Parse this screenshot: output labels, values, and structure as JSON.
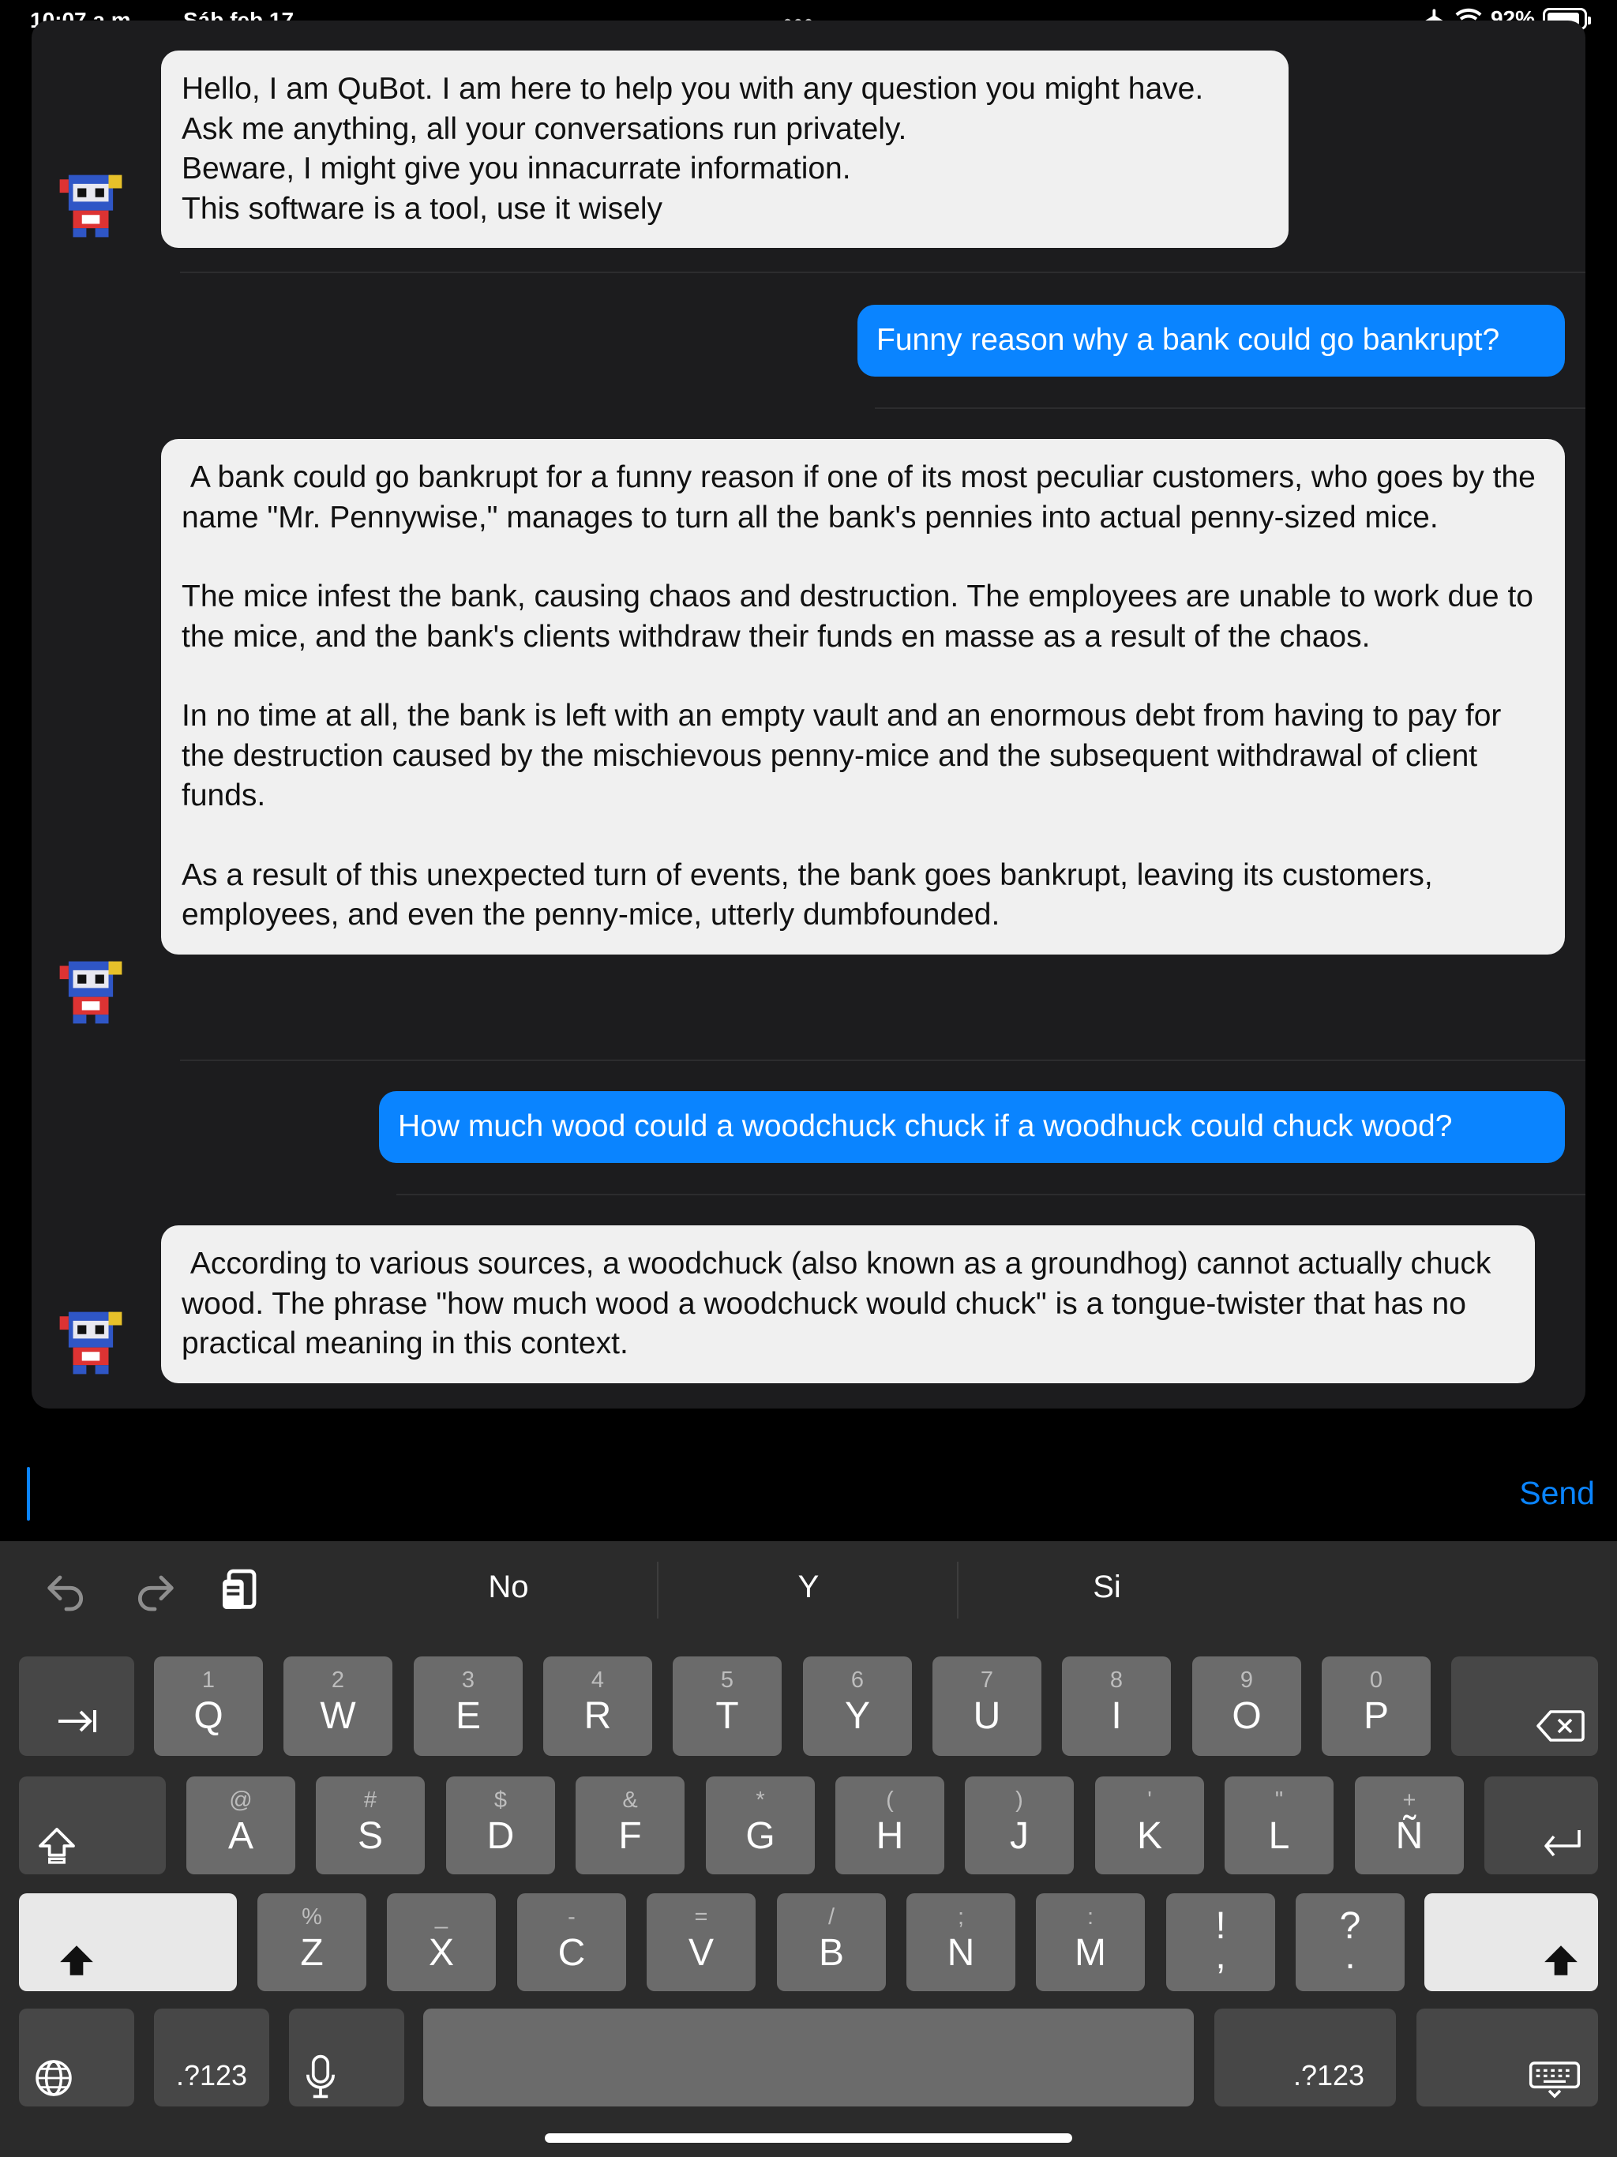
{
  "status_bar": {
    "time": "10:07 a.m.",
    "date": "Sáb feb 17",
    "battery": "92%"
  },
  "chat": {
    "messages": [
      {
        "role": "bot",
        "paragraphs": [
          "Hello, I am QuBot. I am here to help you with any question you might have.\nAsk me anything, all your conversations run privately.\nBeware, I might give you innacurrate information.\nThis software is a tool, use it wisely"
        ]
      },
      {
        "role": "user",
        "text": "Funny reason why a bank could go bankrupt?"
      },
      {
        "role": "bot",
        "paragraphs": [
          " A bank could go bankrupt for a funny reason if one of its most peculiar customers, who goes by the name \"Mr. Pennywise,\" manages to turn all the bank's pennies into actual penny-sized mice.",
          "The mice infest the bank, causing chaos and destruction. The employees are unable to work due to the mice, and the bank's clients withdraw their funds en masse as a result of the chaos.",
          "In no time at all, the bank is left with an empty vault and an enormous debt from having to pay for the destruction caused by the mischievous penny-mice and the subsequent withdrawal of client funds.",
          "As a result of this unexpected turn of events, the bank goes bankrupt, leaving its customers, employees, and even the penny-mice, utterly dumbfounded."
        ]
      },
      {
        "role": "user",
        "text": "How much wood could a woodchuck chuck if a woodhuck could chuck wood?"
      },
      {
        "role": "bot",
        "paragraphs": [
          " According to various sources, a woodchuck (also known as a groundhog) cannot actually chuck wood. The phrase \"how much wood a woodchuck would chuck\" is a tongue-twister that has no practical meaning in this context."
        ]
      }
    ]
  },
  "input": {
    "send_label": "Send"
  },
  "keyboard": {
    "suggestions": [
      "No",
      "Y",
      "Si"
    ],
    "row1": [
      {
        "sec": "1",
        "pri": "Q"
      },
      {
        "sec": "2",
        "pri": "W"
      },
      {
        "sec": "3",
        "pri": "E"
      },
      {
        "sec": "4",
        "pri": "R"
      },
      {
        "sec": "5",
        "pri": "T"
      },
      {
        "sec": "6",
        "pri": "Y"
      },
      {
        "sec": "7",
        "pri": "U"
      },
      {
        "sec": "8",
        "pri": "I"
      },
      {
        "sec": "9",
        "pri": "O"
      },
      {
        "sec": "0",
        "pri": "P"
      }
    ],
    "row2": [
      {
        "sec": "@",
        "pri": "A"
      },
      {
        "sec": "#",
        "pri": "S"
      },
      {
        "sec": "$",
        "pri": "D"
      },
      {
        "sec": "&",
        "pri": "F"
      },
      {
        "sec": "*",
        "pri": "G"
      },
      {
        "sec": "(",
        "pri": "H"
      },
      {
        "sec": ")",
        "pri": "J"
      },
      {
        "sec": "'",
        "pri": "K"
      },
      {
        "sec": "\"",
        "pri": "L"
      },
      {
        "sec": "+",
        "pri": "Ñ"
      }
    ],
    "row3": [
      {
        "sec": "%",
        "pri": "Z"
      },
      {
        "sec": "_",
        "pri": "X"
      },
      {
        "sec": "-",
        "pri": "C"
      },
      {
        "sec": "=",
        "pri": "V"
      },
      {
        "sec": "/",
        "pri": "B"
      },
      {
        "sec": ";",
        "pri": "N"
      },
      {
        "sec": ":",
        "pri": "M"
      },
      {
        "sec": "!",
        "pri": ","
      },
      {
        "sec": "?",
        "pri": "."
      }
    ],
    "numbers_label": ".?123"
  },
  "colors": {
    "accent": "#0a84ff",
    "bot_bubble": "#f0f0f0",
    "panel": "#1c1c1e"
  }
}
